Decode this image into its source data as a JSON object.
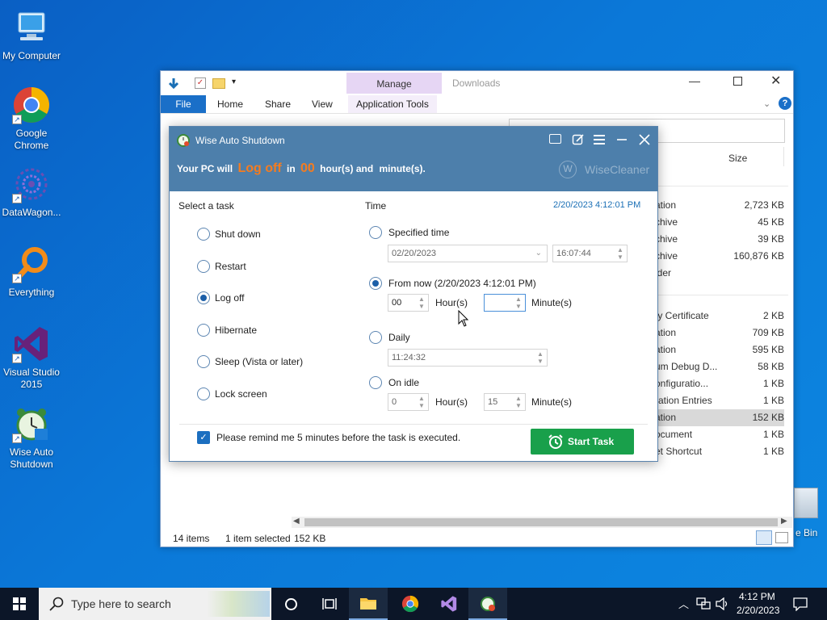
{
  "desktop": {
    "icons": [
      {
        "label": "My Computer"
      },
      {
        "label": "Google Chrome"
      },
      {
        "label": "DataWagon..."
      },
      {
        "label": "Everything"
      },
      {
        "label": "Visual Studio 2015"
      },
      {
        "label": "Wise Auto Shutdown"
      }
    ],
    "recycle_label": "e Bin"
  },
  "explorer": {
    "manage_label": "Manage",
    "title": "Downloads",
    "tabs": {
      "file": "File",
      "home": "Home",
      "share": "Share",
      "view": "View",
      "app_tools": "Application Tools"
    },
    "size_header": "Size",
    "files": [
      {
        "name": "ation",
        "size": "2,723 KB"
      },
      {
        "name": "chive",
        "size": "45 KB"
      },
      {
        "name": "chive",
        "size": "39 KB"
      },
      {
        "name": "chive",
        "size": "160,876 KB"
      },
      {
        "name": "lder",
        "size": ""
      },
      {
        "name": "ty Certificate",
        "size": "2 KB"
      },
      {
        "name": "ation",
        "size": "709 KB"
      },
      {
        "name": "ation",
        "size": "595 KB"
      },
      {
        "name": "um Debug D...",
        "size": "58 KB"
      },
      {
        "name": "onfiguratio...",
        "size": "1 KB"
      },
      {
        "name": "ration Entries",
        "size": "1 KB"
      },
      {
        "name": "ation",
        "size": "152 KB"
      },
      {
        "name": "ocument",
        "size": "1 KB"
      },
      {
        "name": "et Shortcut",
        "size": "1 KB"
      }
    ],
    "status": {
      "items": "14 items",
      "selected": "1 item selected",
      "size": "152 KB"
    }
  },
  "dialog": {
    "title": "Wise Auto Shutdown",
    "headline": {
      "pre": "Your PC will",
      "action": "Log off",
      "in": "in",
      "hours": "00",
      "mid": "hour(s) and",
      "post": "minute(s)."
    },
    "brand": "WiseCleaner",
    "select_task_label": "Select a task",
    "time_label": "Time",
    "current_time": "2/20/2023 4:12:01 PM",
    "tasks": [
      "Shut down",
      "Restart",
      "Log off",
      "Hibernate",
      "Sleep (Vista or later)",
      "Lock screen"
    ],
    "selected_task": "Log off",
    "specified": {
      "label": "Specified time",
      "date": "02/20/2023",
      "time": "16:07:44"
    },
    "from_now": {
      "label": "From now (2/20/2023 4:12:01 PM)",
      "hours": "00",
      "hours_label": "Hour(s)",
      "minutes": "",
      "minutes_label": "Minute(s)"
    },
    "daily": {
      "label": "Daily",
      "time": "11:24:32"
    },
    "on_idle": {
      "label": "On idle",
      "hours": "0",
      "hours_label": "Hour(s)",
      "minutes": "15",
      "minutes_label": "Minute(s)"
    },
    "remind_label": "Please remind me 5 minutes before the task is executed.",
    "remind_checked": true,
    "start_button": "Start Task"
  },
  "taskbar": {
    "search_placeholder": "Type here to search",
    "clock_time": "4:12 PM",
    "clock_date": "2/20/2023"
  },
  "colors": {
    "accent_orange": "#f47c20",
    "header_blue": "#4d7fab",
    "start_green": "#19a04b",
    "link_blue": "#1a6fb5"
  }
}
